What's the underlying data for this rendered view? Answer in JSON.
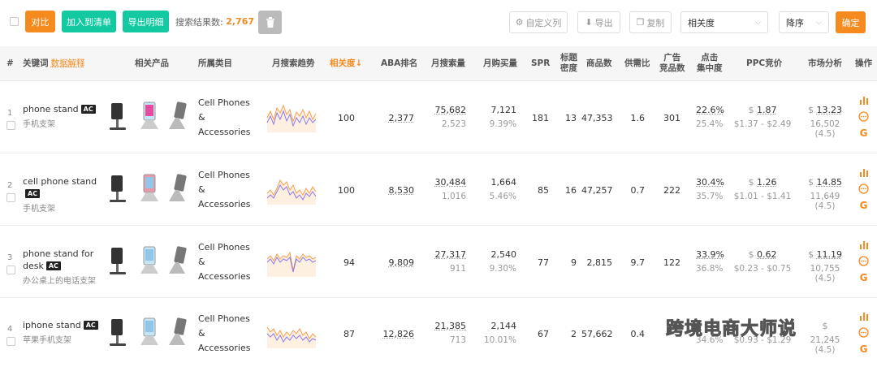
{
  "toolbar": {
    "compare_label": "对比",
    "add_list_label": "加入到清单",
    "export_detail_label": "导出明细",
    "result_label": "搜索结果数:",
    "result_count": "2,767",
    "custom_cols_label": "自定义列",
    "export_label": "导出",
    "copy_label": "复制",
    "sort_field": "相关度",
    "sort_order": "降序",
    "confirm_label": "确定"
  },
  "header": {
    "num": "#",
    "keyword": "关键词",
    "data_explain": "数据解释",
    "products": "相关产品",
    "category": "所属类目",
    "trend": "月搜索趋势",
    "relevance": "相关度↓",
    "aba": "ABA排名",
    "monthly_search": "月搜索量",
    "monthly_buy": "月购买量",
    "spr": "SPR",
    "title_density_1": "标题",
    "title_density_2": "密度",
    "products_count": "商品数",
    "supply_demand": "供需比",
    "ad_products_1": "广告",
    "ad_products_2": "竞品数",
    "click_1": "点击",
    "click_2": "集中度",
    "ppc": "PPC竞价",
    "market": "市场分析",
    "ops": "操作"
  },
  "rows": [
    {
      "num": "1",
      "kw1": "phone stand",
      "kw2": "",
      "kw_cn": "手机支架",
      "cat1": "Cell Phones",
      "cat2": "&",
      "cat3": "Accessories",
      "relevance": "100",
      "aba": "2,377",
      "search": "75,682",
      "search_sub": "2,523",
      "buy": "7,121",
      "buy_pct": "9.39%",
      "spr": "181",
      "density": "13",
      "products": "47,353",
      "sd": "1.6",
      "ad": "301",
      "click": "22.6%",
      "click_sub": "25.4%",
      "ppc": "1.87",
      "ppc_range": "$1.37 - $2.49",
      "market": "13.23",
      "market_sub": "16,502 (4.5)"
    },
    {
      "num": "2",
      "kw1": "cell phone stand",
      "kw2": "",
      "kw_cn": "手机支架",
      "cat1": "Cell Phones",
      "cat2": "&",
      "cat3": "Accessories",
      "relevance": "100",
      "aba": "8,530",
      "search": "30,484",
      "search_sub": "1,016",
      "buy": "1,664",
      "buy_pct": "5.46%",
      "spr": "85",
      "density": "16",
      "products": "47,257",
      "sd": "0.7",
      "ad": "222",
      "click": "30.4%",
      "click_sub": "35.7%",
      "ppc": "1.26",
      "ppc_range": "$1.01 - $1.41",
      "market": "14.85",
      "market_sub": "11,649 (4.5)"
    },
    {
      "num": "3",
      "kw1": "phone stand for",
      "kw2": "desk",
      "kw_cn": "办公桌上的电话支架",
      "cat1": "Cell Phones",
      "cat2": "&",
      "cat3": "Accessories",
      "relevance": "94",
      "aba": "9,809",
      "search": "27,317",
      "search_sub": "911",
      "buy": "2,540",
      "buy_pct": "9.30%",
      "spr": "77",
      "density": "9",
      "products": "2,815",
      "sd": "9.7",
      "ad": "122",
      "click": "33.9%",
      "click_sub": "36.8%",
      "ppc": "0.62",
      "ppc_range": "$0.23 - $0.75",
      "market": "11.19",
      "market_sub": "10,755 (4.5)"
    },
    {
      "num": "4",
      "kw1": "iphone stand",
      "kw2": "",
      "kw_cn": "苹果手机支架",
      "cat1": "Cell Phones",
      "cat2": "&",
      "cat3": "Accessories",
      "relevance": "87",
      "aba": "12,826",
      "search": "21,385",
      "search_sub": "713",
      "buy": "2,144",
      "buy_pct": "10.01%",
      "spr": "67",
      "density": "2",
      "products": "57,662",
      "sd": "0.4",
      "ad": "",
      "click": "3",
      "click_sub": "34.6%",
      "ppc": "",
      "ppc_range": "$0.93 - $1.29",
      "market": "",
      "market_sub": "21,245 (4.5)"
    }
  ],
  "watermark": "跨境电商大师说",
  "colors": {
    "accent": "#f58a1f",
    "teal": "#13c9a2",
    "trend_orange": "#f5a04a",
    "trend_purple": "#8c7ae6"
  }
}
